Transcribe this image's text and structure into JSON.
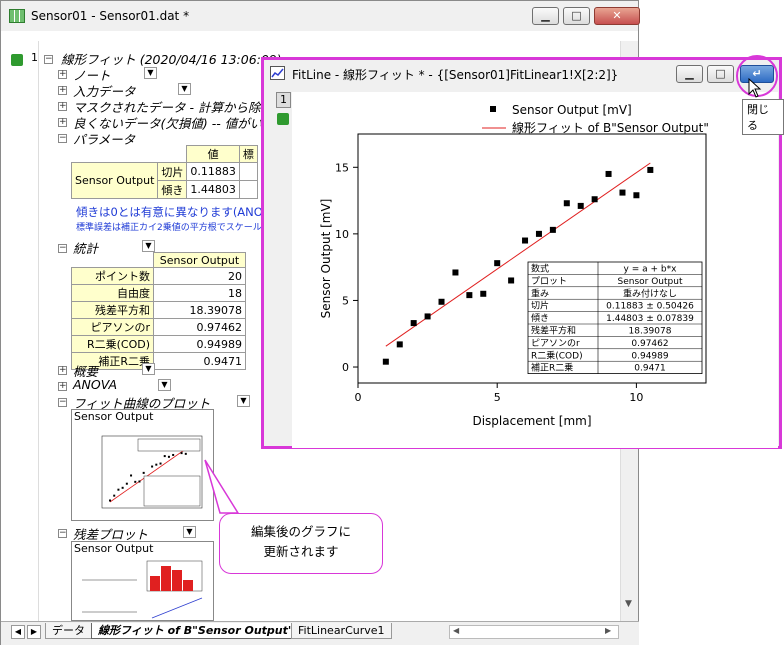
{
  "back_window": {
    "title": "Sensor01 - Sensor01.dat *",
    "sheet_index": "1",
    "report_title": "線形フィット (2020/04/16 13:06:09)",
    "nodes": {
      "notes": "ノート",
      "input": "入力データ",
      "masked": "マスクされたデータ - 計算から除",
      "bad": "良くないデータ(欠損値) -- 値がい",
      "params": "パラメータ",
      "stats": "統計",
      "summary": "概要",
      "anova": "ANOVA",
      "fitplot": "フィット曲線のプロット",
      "residual": "残差プロット"
    },
    "param_table": {
      "header": "値",
      "header2": "標",
      "row_label": "Sensor Output",
      "rows": [
        {
          "name": "切片",
          "value": "0.11883"
        },
        {
          "name": "傾き",
          "value": "1.44803"
        }
      ]
    },
    "note1": "傾きは0とは有意に異なります(ANOVA表",
    "note2": "標準誤差は補正カイ2乗値の平方根でスケールされて",
    "stats_table": {
      "header": "Sensor Output",
      "rows": [
        {
          "name": "ポイント数",
          "value": "20"
        },
        {
          "name": "自由度",
          "value": "18"
        },
        {
          "name": "残差平方和",
          "value": "18.39078"
        },
        {
          "name": "ピアソンのr",
          "value": "0.97462"
        },
        {
          "name": "R二乗(COD)",
          "value": "0.94989"
        },
        {
          "name": "補正R二乗",
          "value": "0.9471"
        }
      ]
    },
    "thumb_label": "Sensor Output",
    "thumb2_label": "Sensor Output",
    "tabs": {
      "data": "データ",
      "fit": "線形フィット of B\"Sensor Output\"",
      "curve": "FitLinearCurve1"
    }
  },
  "front_window": {
    "title": "FitLine - 線形フィット * - {[Sensor01]FitLinear1!X[2:2]}",
    "layer": "1",
    "tooltip": "閉じる",
    "legend_points": "Sensor Output [mV]",
    "legend_line": "線形フィット of B\"Sensor Output\""
  },
  "callout": {
    "line1": "編集後のグラフに",
    "line2": "更新されます"
  },
  "fit_table": {
    "rows": [
      [
        "数式",
        "y = a + b*x"
      ],
      [
        "プロット",
        "Sensor Output"
      ],
      [
        "重み",
        "重み付けなし"
      ],
      [
        "切片",
        "0.11883 ± 0.50426"
      ],
      [
        "傾き",
        "1.44803 ± 0.07839"
      ],
      [
        "残差平方和",
        "18.39078"
      ],
      [
        "ピアソンのr",
        "0.97462"
      ],
      [
        "R二乗(COD)",
        "0.94989"
      ],
      [
        "補正R二乗",
        "0.9471"
      ]
    ]
  },
  "chart_data": {
    "type": "scatter",
    "xlabel": "Displacement [mm]",
    "ylabel": "Sensor Output [mV]",
    "xlim": [
      0,
      12.5
    ],
    "ylim": [
      -1.2,
      17.5
    ],
    "xticks": [
      0,
      5,
      10
    ],
    "yticks": [
      0,
      5,
      10,
      15
    ],
    "series": [
      {
        "name": "Sensor Output [mV]",
        "points": [
          [
            1.0,
            0.4
          ],
          [
            1.5,
            1.7
          ],
          [
            2.0,
            3.3
          ],
          [
            2.5,
            3.8
          ],
          [
            3.0,
            4.9
          ],
          [
            3.5,
            7.1
          ],
          [
            4.0,
            5.4
          ],
          [
            4.5,
            5.5
          ],
          [
            5.0,
            7.8
          ],
          [
            5.5,
            6.5
          ],
          [
            6.0,
            9.5
          ],
          [
            6.5,
            10.0
          ],
          [
            7.0,
            10.3
          ],
          [
            7.5,
            12.3
          ],
          [
            8.0,
            12.1
          ],
          [
            8.5,
            12.6
          ],
          [
            9.0,
            14.5
          ],
          [
            9.5,
            13.1
          ],
          [
            10.0,
            12.9
          ],
          [
            10.5,
            14.8
          ]
        ]
      }
    ],
    "fit_line": {
      "name": "線形フィット of B\"Sensor Output\"",
      "intercept": 0.11883,
      "slope": 1.44803,
      "x_range": [
        1.0,
        10.5
      ]
    },
    "colors": {
      "line": "#e02020",
      "points": "#000000"
    },
    "legend": "top-right"
  }
}
